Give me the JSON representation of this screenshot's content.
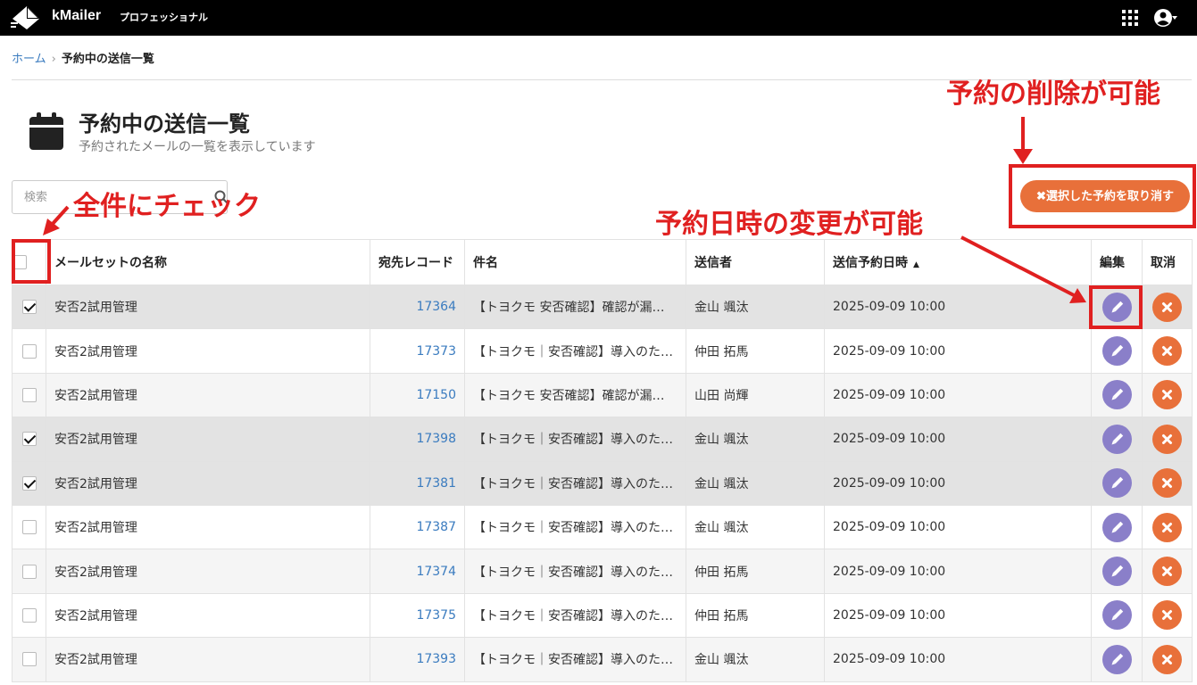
{
  "app": {
    "name": "kMailer",
    "edition": "プロフェッショナル"
  },
  "breadcrumb": {
    "home": "ホーム",
    "current": "予約中の送信一覧"
  },
  "page": {
    "title": "予約中の送信一覧",
    "subtitle": "予約されたメールの一覧を表示しています"
  },
  "search": {
    "placeholder": "検索"
  },
  "actions": {
    "cancel_selected_label": "✖選択した予約を取り消す"
  },
  "table": {
    "columns": [
      "メールセットの名称",
      "宛先レコード",
      "件名",
      "送信者",
      "送信予約日時",
      "編集",
      "取消"
    ],
    "sort_indicator": "▲",
    "rows": [
      {
        "checked": true,
        "name": "安否2試用管理",
        "record": "17364",
        "subject": "【トヨクモ 安否確認】確認が漏…",
        "sender": "金山 颯汰",
        "datetime": "2025-09-09 10:00"
      },
      {
        "checked": false,
        "name": "安否2試用管理",
        "record": "17373",
        "subject": "【トヨクモ｜安否確認】導入のた…",
        "sender": "仲田 拓馬",
        "datetime": "2025-09-09 10:00"
      },
      {
        "checked": false,
        "name": "安否2試用管理",
        "record": "17150",
        "subject": "【トヨクモ 安否確認】確認が漏…",
        "sender": "山田 尚輝",
        "datetime": "2025-09-09 10:00"
      },
      {
        "checked": true,
        "name": "安否2試用管理",
        "record": "17398",
        "subject": "【トヨクモ｜安否確認】導入のた…",
        "sender": "金山 颯汰",
        "datetime": "2025-09-09 10:00"
      },
      {
        "checked": true,
        "name": "安否2試用管理",
        "record": "17381",
        "subject": "【トヨクモ｜安否確認】導入のた…",
        "sender": "金山 颯汰",
        "datetime": "2025-09-09 10:00"
      },
      {
        "checked": false,
        "name": "安否2試用管理",
        "record": "17387",
        "subject": "【トヨクモ｜安否確認】導入のた…",
        "sender": "金山 颯汰",
        "datetime": "2025-09-09 10:00"
      },
      {
        "checked": false,
        "name": "安否2試用管理",
        "record": "17374",
        "subject": "【トヨクモ｜安否確認】導入のた…",
        "sender": "仲田 拓馬",
        "datetime": "2025-09-09 10:00"
      },
      {
        "checked": false,
        "name": "安否2試用管理",
        "record": "17375",
        "subject": "【トヨクモ｜安否確認】導入のた…",
        "sender": "仲田 拓馬",
        "datetime": "2025-09-09 10:00"
      },
      {
        "checked": false,
        "name": "安否2試用管理",
        "record": "17393",
        "subject": "【トヨクモ｜安否確認】導入のた…",
        "sender": "金山 颯汰",
        "datetime": "2025-09-09 10:00"
      }
    ]
  },
  "annotations": {
    "check_all": "全件にチェック",
    "delete_possible": "予約の削除が可能",
    "change_possible": "予約日時の変更が可能"
  },
  "icons": {
    "logo": "kmailer-logo-icon",
    "apps": "grid-icon",
    "user": "user-circle-icon",
    "calendar": "calendar-icon",
    "search": "search-icon",
    "edit": "pencil-icon",
    "delete": "close-icon"
  },
  "colors": {
    "topbar": "#000000",
    "link": "#3a7bbf",
    "cancel_button": "#e8703a",
    "edit_button": "#8a7fc9",
    "annotation": "#e02020"
  }
}
